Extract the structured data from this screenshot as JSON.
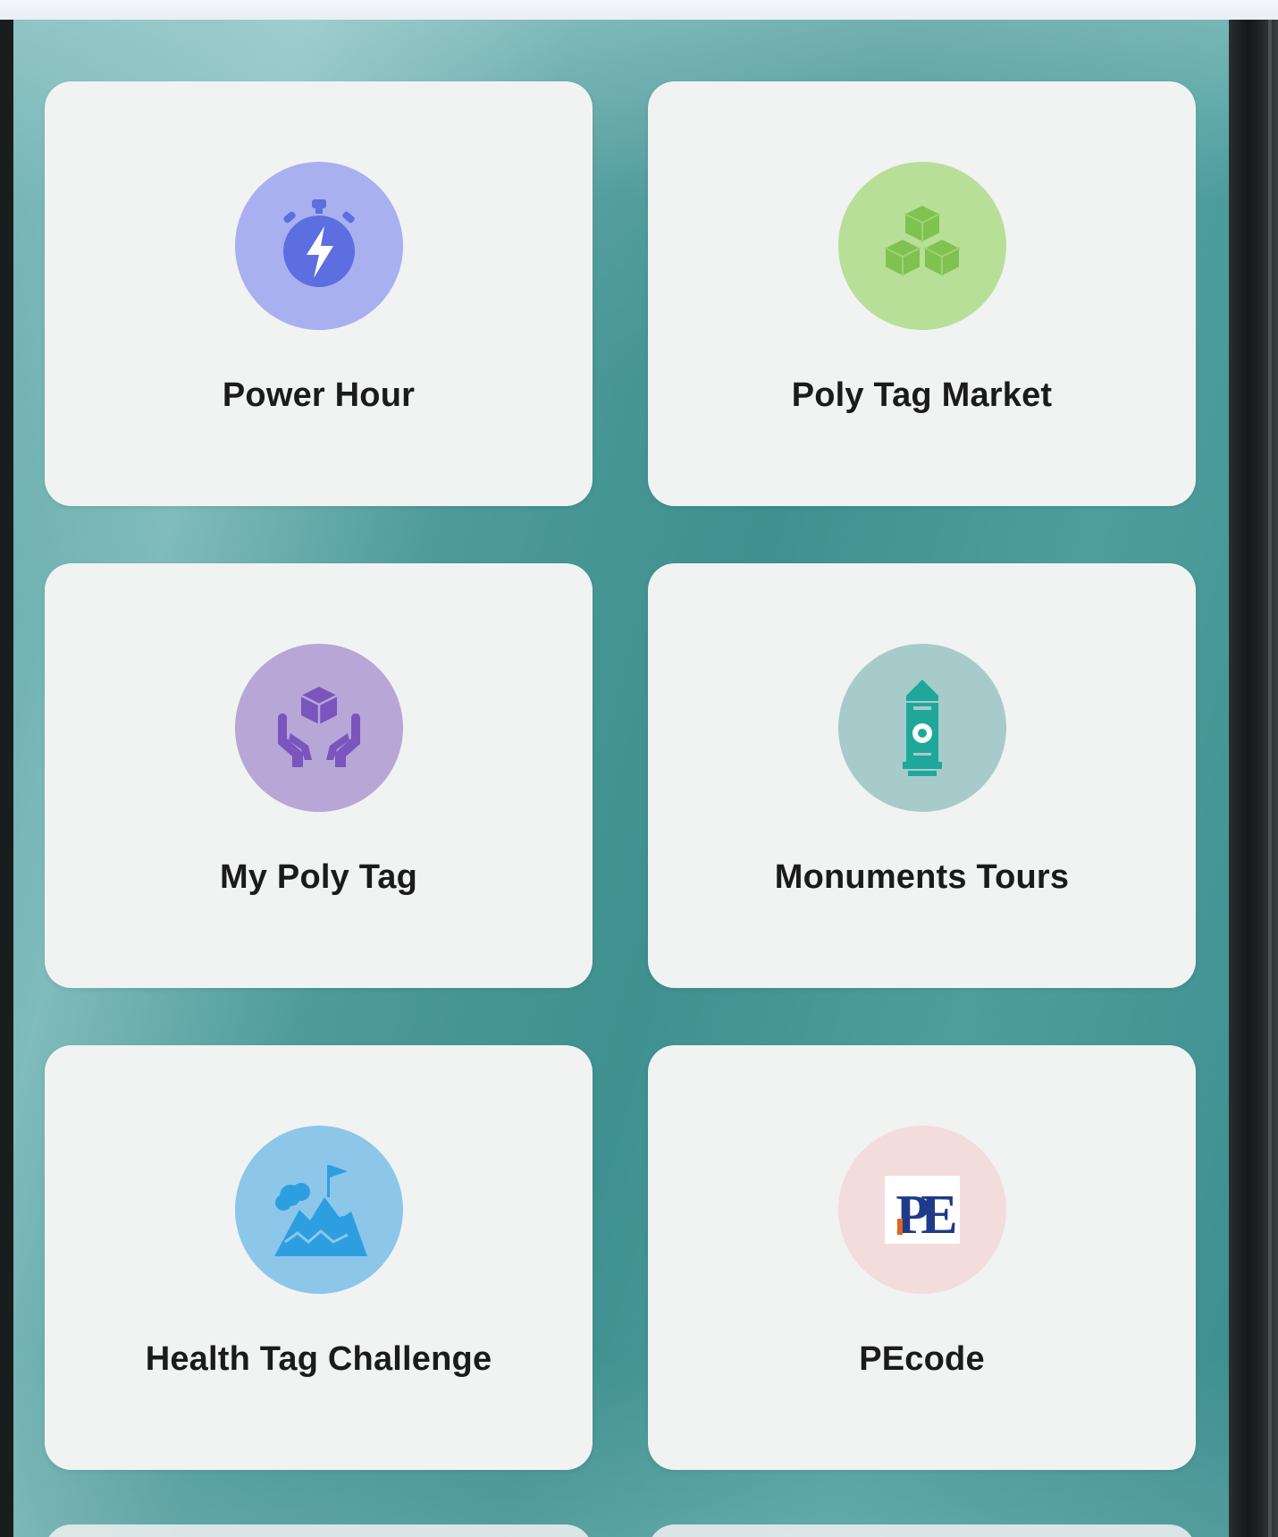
{
  "tiles": [
    {
      "label": "Power Hour",
      "icon": "stopwatch-bolt-icon",
      "circle_color": "#a9b0ef",
      "icon_color": "#5c6ee0"
    },
    {
      "label": "Poly Tag Market",
      "icon": "cubes-icon",
      "circle_color": "#b7df98",
      "icon_color": "#7fc24f"
    },
    {
      "label": "My Poly Tag",
      "icon": "hands-cube-icon",
      "circle_color": "#b7a6d6",
      "icon_color": "#7a55bd"
    },
    {
      "label": "Monuments Tours",
      "icon": "monument-tower-icon",
      "circle_color": "#a7cbcb",
      "icon_color": "#1fa89a"
    },
    {
      "label": "Health Tag Challenge",
      "icon": "mountain-flag-icon",
      "circle_color": "#8cc7ea",
      "icon_color": "#2d9fe0"
    },
    {
      "label": "PEcode",
      "icon": "pe-logo-icon",
      "logo_text": "PE",
      "circle_color": "#f3dcdc",
      "icon_color": "#1f3a8a",
      "accent_color": "#e0651d"
    }
  ]
}
